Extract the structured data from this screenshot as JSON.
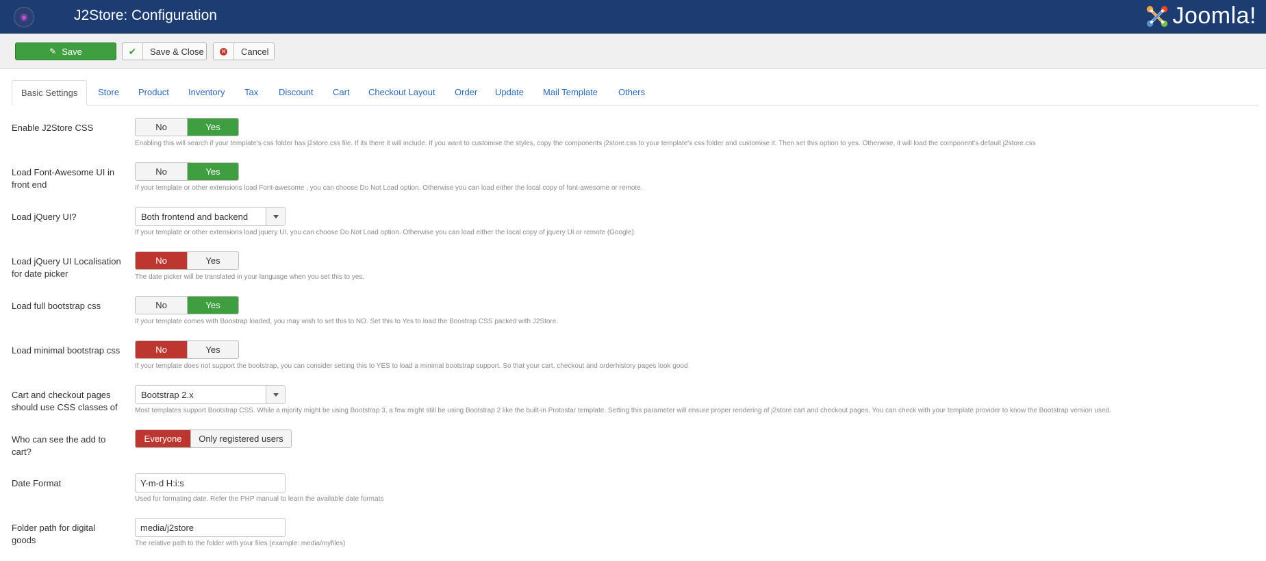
{
  "header": {
    "title": "J2Store: Configuration",
    "logo_text": "Joomla!",
    "app_icon": "cart-icon"
  },
  "toolbar": {
    "save_label": "Save",
    "save_close_label": "Save & Close",
    "cancel_label": "Cancel"
  },
  "tabs": [
    "Basic Settings",
    "Store",
    "Product",
    "Inventory",
    "Tax",
    "Discount",
    "Cart",
    "Checkout Layout",
    "Order",
    "Update",
    "Mail Template",
    "Others"
  ],
  "active_tab": "Basic Settings",
  "settings": [
    {
      "label": "Enable J2Store CSS",
      "type": "toggle",
      "options": [
        "No",
        "Yes"
      ],
      "selected": "Yes",
      "help": "Enabling this will search if your template's css folder has j2store.css file. If its there it will include. If you want to customise the styles, copy the components j2store.css to your template's css folder and customise it. Then set this option to yes. Otherwise, it will load the component's default j2store.css"
    },
    {
      "label": "Load Font-Awesome UI in front end",
      "type": "toggle",
      "options": [
        "No",
        "Yes"
      ],
      "selected": "Yes",
      "help": "If your template or other extensions load Font-awesome , you can choose Do Not Load option. Otherwise you can load either the local copy of font-awesome or remote."
    },
    {
      "label": "Load jQuery UI?",
      "type": "select",
      "value": "Both frontend and backend",
      "help": "If your template or other extensions load jquery UI, you can choose Do Not Load option. Otherwise you can load either the local copy of jquery UI or remote (Google)."
    },
    {
      "label": "Load jQuery UI Localisation for date picker",
      "type": "toggle",
      "options": [
        "No",
        "Yes"
      ],
      "selected": "No",
      "help": "The date picker will be translated in your language when you set this to yes."
    },
    {
      "label": "Load full bootstrap css",
      "type": "toggle",
      "options": [
        "No",
        "Yes"
      ],
      "selected": "Yes",
      "help": "If your template comes with Boostrap loaded, you may wish to set this to NO. Set this to Yes to load the Boostrap CSS packed with J2Store."
    },
    {
      "label": "Load minimal bootstrap css",
      "type": "toggle",
      "options": [
        "No",
        "Yes"
      ],
      "selected": "No",
      "help": "If your template does not support the bootstrap, you can consider setting this to YES to load a minimal bootstrap support. So that your cart, checkout and orderhistory pages look good"
    },
    {
      "label": "Cart and checkout pages should use CSS classes of",
      "type": "select",
      "value": "Bootstrap 2.x",
      "help": "Most templates support Bootstrap CSS. While a mjority might be using Bootstrap 3, a few might still be using Bootstrap 2 like the built-in Protostar template. Setting this parameter will ensure proper rendering of j2store cart and checkout pages. You can check with your template provider to know the Bootstrap version used."
    },
    {
      "label": "Who can see the add to cart?",
      "type": "toggle",
      "options": [
        "Everyone",
        "Only registered users"
      ],
      "selected": "Everyone",
      "help": ""
    },
    {
      "label": "Date Format",
      "type": "input",
      "value": "Y-m-d H:i:s",
      "help": "Used for formating date. Refer the PHP manual to learn the available date formats"
    },
    {
      "label": "Folder path for digital goods",
      "type": "input",
      "value": "media/j2store",
      "help": "The relative path to the folder with your files (example: media/myfiles)"
    }
  ],
  "colors": {
    "header_bg": "#1c3c72",
    "accent_green": "#3f9e3f",
    "accent_red": "#bd362f",
    "link_blue": "#2a69b8"
  }
}
